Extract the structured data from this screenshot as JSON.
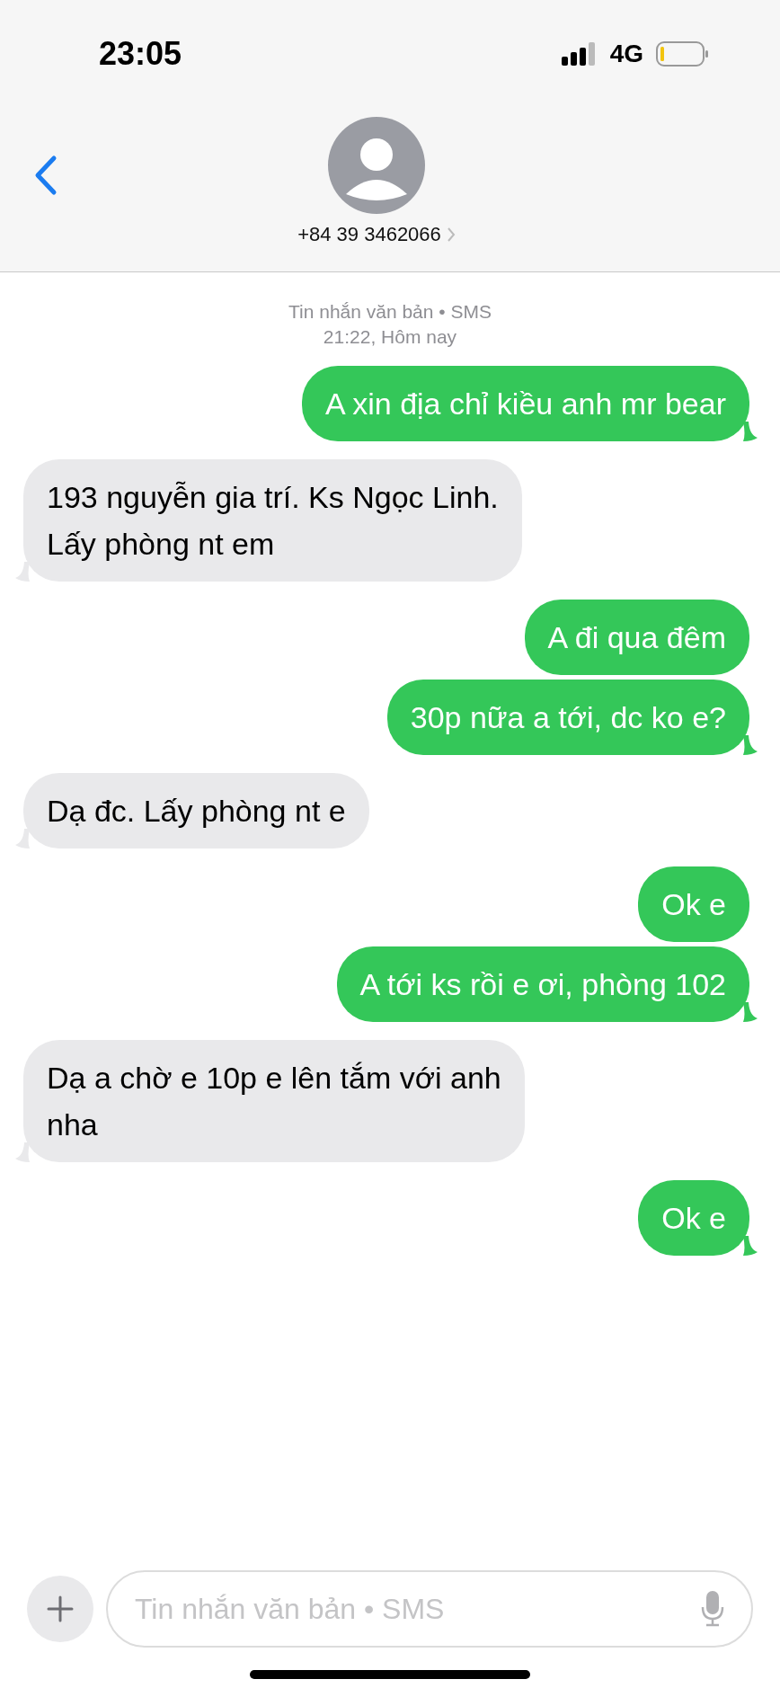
{
  "status_bar": {
    "time": "23:05",
    "network": "4G"
  },
  "header": {
    "contact": "+84 39 3462066"
  },
  "thread_info": {
    "service": "Tin nhắn văn bản • SMS",
    "timestamp": "21:22, Hôm nay"
  },
  "messages": [
    {
      "kind": "sent",
      "text": "A xin địa chỉ kiều anh mr bear"
    },
    {
      "kind": "received",
      "text": "193 nguyễn gia trí. Ks Ngọc Linh.\nLấy phòng nt em"
    },
    {
      "kind": "sent",
      "text": "A đi qua đêm"
    },
    {
      "kind": "sent",
      "text": "30p nữa a tới, dc ko e?"
    },
    {
      "kind": "received",
      "text": "Dạ đc. Lấy phòng nt e"
    },
    {
      "kind": "sent",
      "text": "Ok e"
    },
    {
      "kind": "sent",
      "text": "A tới ks rồi e ơi, phòng 102"
    },
    {
      "kind": "received",
      "text": "Dạ a chờ e 10p e lên tắm với anh\nnha"
    },
    {
      "kind": "sent",
      "text": "Ok e"
    }
  ],
  "composer": {
    "placeholder": "Tin nhắn văn bản • SMS"
  }
}
